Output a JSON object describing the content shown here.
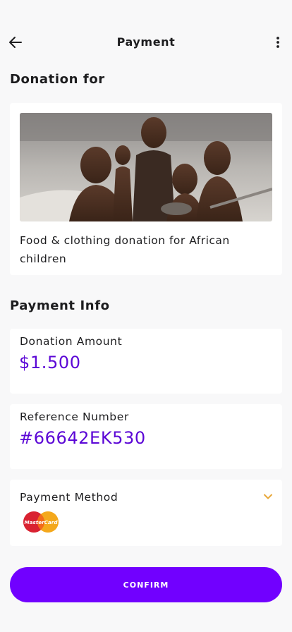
{
  "header": {
    "title": "Payment",
    "back_icon": "arrow-left-icon",
    "more_icon": "more-vertical-icon"
  },
  "donation": {
    "section_title": "Donation for",
    "title": "Food & clothing donation for African children"
  },
  "payment_info": {
    "section_title": "Payment Info",
    "amount_label": "Donation Amount",
    "amount_value": "$1.500",
    "reference_label": "Reference Number",
    "reference_value": "#66642EK530",
    "method_label": "Payment Method",
    "method_logo_text": "MasterCard",
    "dropdown_icon": "chevron-down-icon"
  },
  "actions": {
    "confirm_label": "CONFIRM"
  },
  "colors": {
    "accent": "#7100ff",
    "value_text": "#5b06d6",
    "chevron": "#e8a83a",
    "background": "#f8f8f9",
    "card": "#ffffff"
  }
}
